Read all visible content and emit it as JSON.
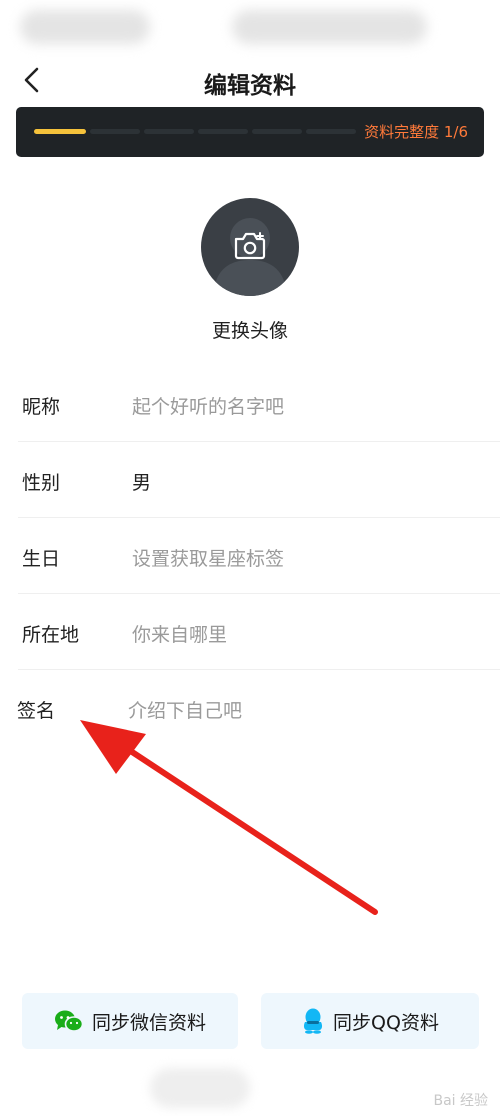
{
  "header": {
    "title": "编辑资料"
  },
  "progress": {
    "label": "资料完整度 1/6",
    "completed": 1,
    "total": 6,
    "accent_color": "#f5c23b",
    "label_color": "#ff7a3a"
  },
  "avatar": {
    "change_label": "更换头像"
  },
  "form": {
    "rows": [
      {
        "label": "昵称",
        "value": "起个好听的名字吧",
        "placeholder": true
      },
      {
        "label": "性别",
        "value": "男",
        "placeholder": false
      },
      {
        "label": "生日",
        "value": "设置获取星座标签",
        "placeholder": true
      },
      {
        "label": "所在地",
        "value": "你来自哪里",
        "placeholder": true
      },
      {
        "label": "签名",
        "value": "介绍下自己吧",
        "placeholder": true
      }
    ]
  },
  "annotation": {
    "arrow_color": "#e8221b"
  },
  "sync": {
    "wechat_label": "同步微信资料",
    "qq_label": "同步QQ资料",
    "wechat_color": "#1aad19",
    "qq_color": "#12b7f5"
  },
  "watermark": {
    "text": "Bai 经验"
  },
  "icons": {
    "back": "chevron-left-icon",
    "camera": "camera-add-icon",
    "wechat": "wechat-icon",
    "qq": "qq-icon"
  }
}
